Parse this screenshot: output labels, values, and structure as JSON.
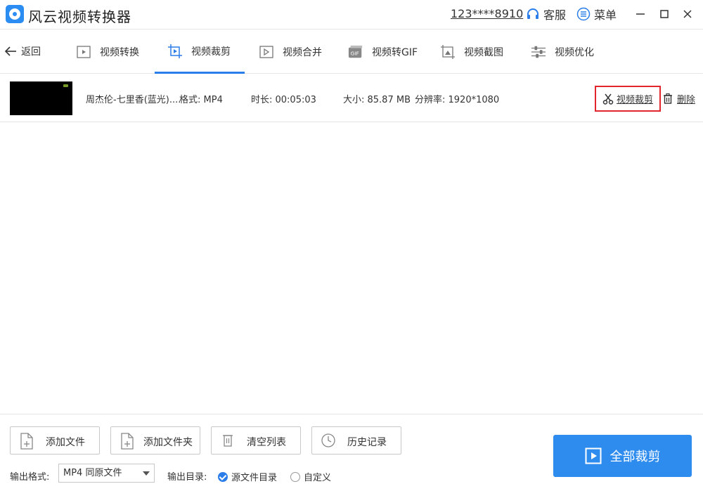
{
  "title_bar": {
    "app_title": "风云视频转换器",
    "account": "123****8910",
    "support_label": "客服",
    "menu_label": "菜单"
  },
  "tabs": {
    "back_label": "返回",
    "items": [
      {
        "label": "视频转换",
        "icon": "video-convert-icon"
      },
      {
        "label": "视频裁剪",
        "icon": "video-crop-icon",
        "active": true
      },
      {
        "label": "视频合并",
        "icon": "video-merge-icon"
      },
      {
        "label": "视频转GIF",
        "icon": "gif-icon"
      },
      {
        "label": "视频截图",
        "icon": "screenshot-icon"
      },
      {
        "label": "视频优化",
        "icon": "optimize-icon"
      }
    ]
  },
  "file": {
    "name": "周杰伦-七里香(蓝光)....",
    "format": "格式: MP4",
    "duration": "时长: 00:05:03",
    "size": "大小: 85.87 MB",
    "resolution": "分辨率: 1920*1080",
    "crop_action": "视频裁剪",
    "delete_action": "删除"
  },
  "bottom": {
    "add_file": "添加文件",
    "add_folder": "添加文件夹",
    "clear_list": "清空列表",
    "history": "历史记录",
    "output_format_label": "输出格式:",
    "output_format_value": "MP4 同原文件",
    "output_dir_label": "输出目录:",
    "dir_source": "源文件目录",
    "dir_custom": "自定义",
    "dir_selected": "源文件目录",
    "start_button": "全部裁剪"
  },
  "colors": {
    "accent": "#2b7de9",
    "start_button": "#2f8cef",
    "highlight_box": "#e0262c"
  }
}
